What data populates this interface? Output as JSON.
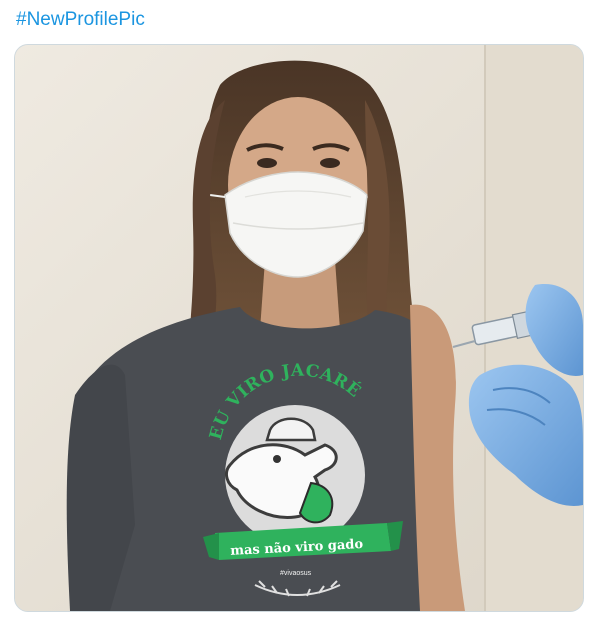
{
  "tweet": {
    "hashtag": "#NewProfilePic"
  },
  "photo": {
    "shirt_headline": "EU VIRO JACARÉ",
    "shirt_banner": "mas não viro gado",
    "shirt_tag": "#vivaosus"
  },
  "colors": {
    "link": "#1b95e0",
    "shirt_green": "#2fb25d",
    "glove_blue": "#7fb2e6",
    "shirt_gray": "#4a4d52",
    "wall": "#e7e1d6"
  }
}
